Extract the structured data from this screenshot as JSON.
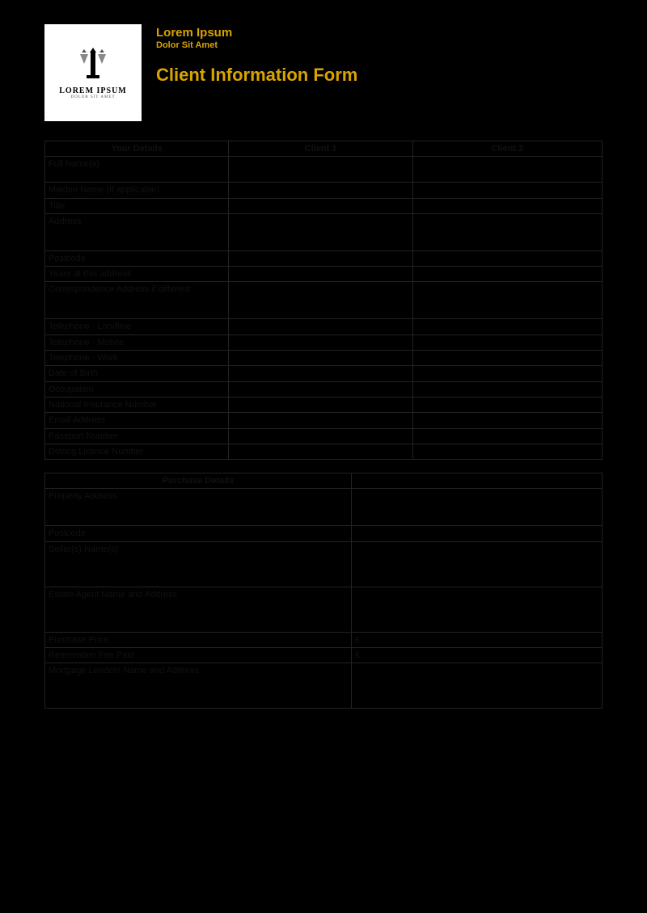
{
  "header": {
    "company": "Lorem Ipsum",
    "tagline": "Dolor Sit Amet",
    "title": "Client Information Form",
    "logo_text": "LOREM IPSUM",
    "logo_sub": "DOLOR SIT AMET"
  },
  "client_table": {
    "col_headers": [
      "Your Details",
      "Client 1",
      "Client 2"
    ],
    "rows": [
      "Full Name(s)",
      "Maiden Name (if applicable)",
      "Title",
      "Address",
      "Postcode",
      "Years at this address",
      "Correspondence Address if different",
      "Telephone - Landline",
      "Telephone - Mobile",
      "Telephone - Work",
      "Date of Birth",
      "Occupation",
      "National Insurance Number",
      "Email Address",
      "Passport Number",
      "Driving Licence Number"
    ]
  },
  "purchase_table": {
    "header": "Purchase Details",
    "rows": [
      {
        "label": "Property Address",
        "value": ""
      },
      {
        "label": "Postcode",
        "value": ""
      },
      {
        "label": "Seller(s) Name(s)",
        "value": ""
      },
      {
        "label": "Estate Agent Name and Address",
        "value": ""
      },
      {
        "label": "Purchase Price",
        "value": "£"
      },
      {
        "label": "Reservation Fee Paid",
        "value": "£"
      },
      {
        "label": "Mortgage Lenders Name and Address",
        "value": ""
      }
    ]
  }
}
